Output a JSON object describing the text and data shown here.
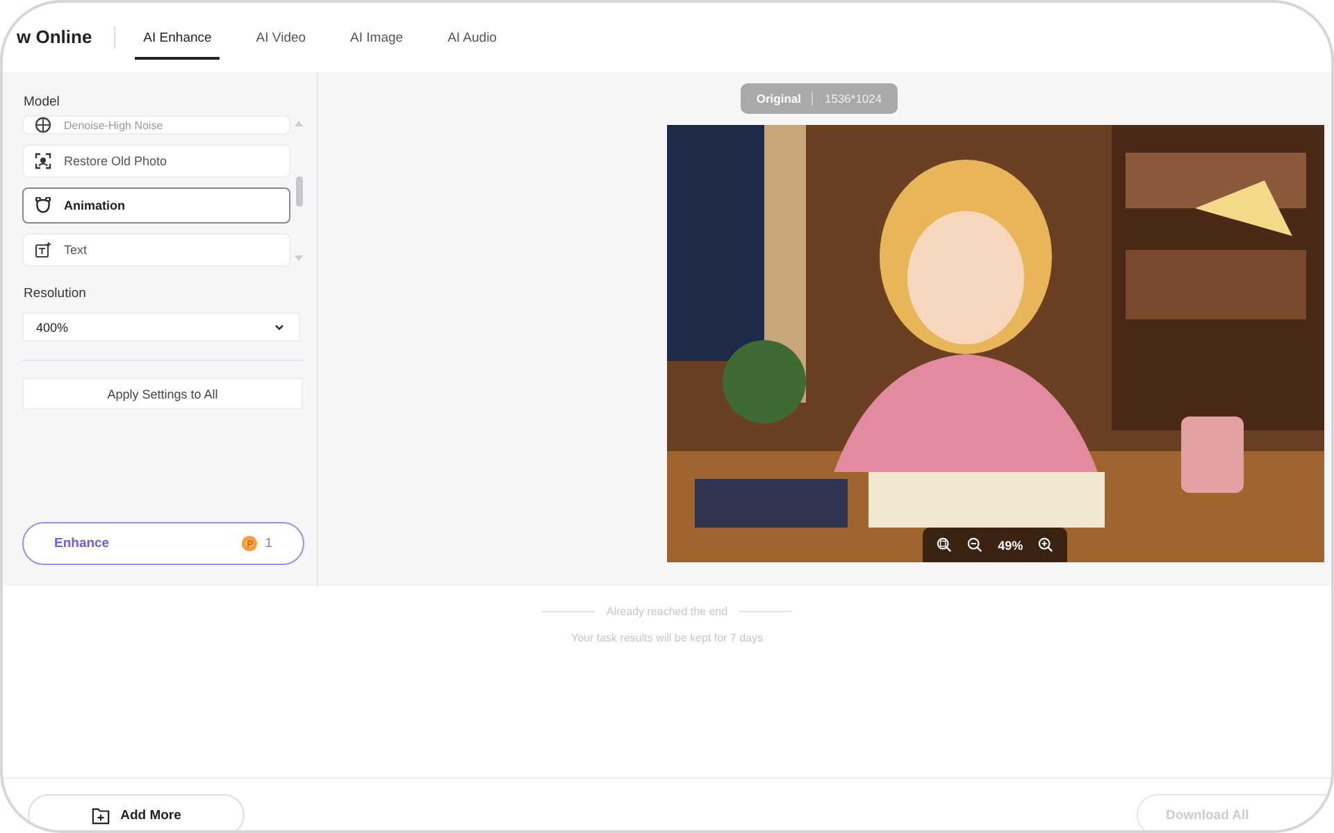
{
  "app": {
    "logo": "w Online"
  },
  "tabs": [
    {
      "label": "AI Enhance",
      "selected": true
    },
    {
      "label": "AI Video",
      "selected": false
    },
    {
      "label": "AI Image",
      "selected": false
    },
    {
      "label": "AI Audio",
      "selected": false
    }
  ],
  "sidebar": {
    "model_label": "Model",
    "models": [
      {
        "label": "Denoise-High Noise",
        "kind": "denoise",
        "selected": false
      },
      {
        "label": "Restore Old Photo",
        "kind": "restore",
        "selected": false
      },
      {
        "label": "Animation",
        "kind": "animation",
        "selected": true
      },
      {
        "label": "Text",
        "kind": "text",
        "selected": false
      }
    ],
    "resolution_label": "Resolution",
    "resolution": {
      "value": "400%"
    },
    "apply_button": "Apply Settings to All",
    "enhance_button": {
      "label": "Enhance",
      "credits": "1"
    }
  },
  "preview": {
    "badge": {
      "label": "Original",
      "size": "1536*1024"
    },
    "zoom": "49%"
  },
  "results": {
    "end_note": "Already reached the end",
    "retention_note": "Your task results will be kept for 7 days"
  },
  "footer": {
    "add_button": "Add More",
    "download_button": {
      "label": "Download All",
      "disabled": true
    }
  }
}
